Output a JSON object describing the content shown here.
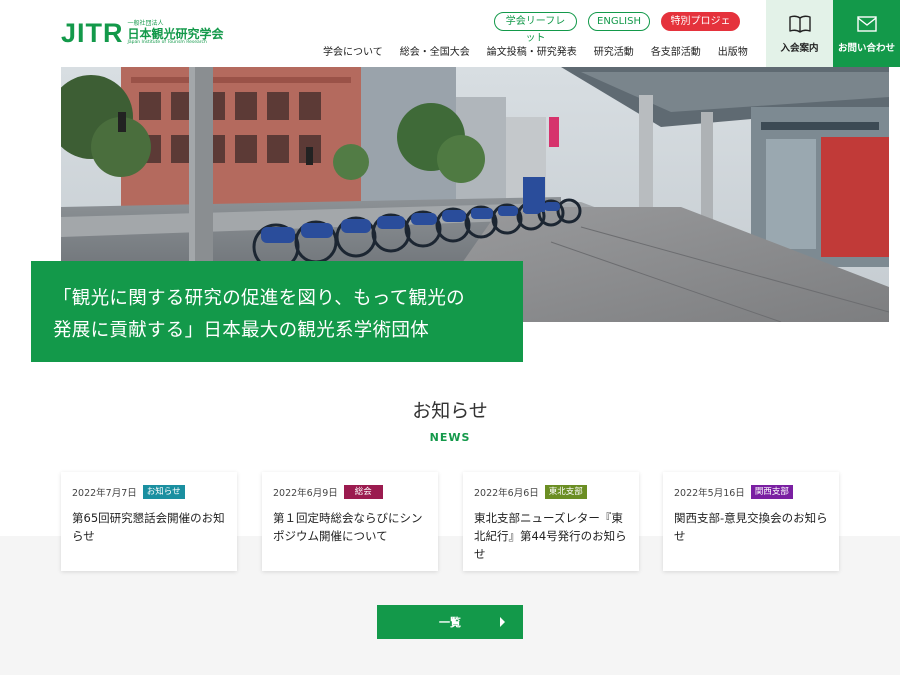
{
  "header": {
    "logo_mark": "JITR",
    "logo_small": "一般社団法人",
    "logo_name": "日本観光研究学会",
    "logo_en": "Japan Institute of Tourism Research",
    "pills": [
      "学会リーフレット",
      "ENGLISH",
      "特別プロジェクト"
    ],
    "nav": [
      "学会について",
      "総会・全国大会",
      "論文投稿・研究発表",
      "研究活動",
      "各支部活動",
      "出版物"
    ],
    "join_label": "入会案内",
    "contact_label": "お問い合わせ"
  },
  "hero": {
    "caption_line1": "「観光に関する研究の促進を図り、もって観光の",
    "caption_line2": "発展に貢献する」日本最大の観光系学術団体"
  },
  "news": {
    "title": "お知らせ",
    "subtitle": "NEWS",
    "items": [
      {
        "date": "2022年7月7日",
        "tag": "お知らせ",
        "tag_color": "#1a8fa0",
        "title": "第65回研究懇話会開催のお知らせ"
      },
      {
        "date": "2022年6月9日",
        "tag": "総会",
        "tag_color": "#9b1b4f",
        "title": "第１回定時総会ならびにシンポジウム開催について"
      },
      {
        "date": "2022年6月6日",
        "tag": "東北支部",
        "tag_color": "#6b8e23",
        "title": "東北支部ニューズレター『東北紀行』第44号発行のお知らせ"
      },
      {
        "date": "2022年5月16日",
        "tag": "関西支部",
        "tag_color": "#7a1fa2",
        "title": "関西支部-意見交換会のお知らせ"
      }
    ],
    "more_label": "一覧"
  },
  "colors": {
    "brand_green": "#13994a",
    "accent_red": "#e5323c",
    "join_bg": "#e3f2e8"
  },
  "icons": {
    "join": "open-book-icon",
    "contact": "envelope-icon",
    "more": "chevron-right-icon"
  }
}
